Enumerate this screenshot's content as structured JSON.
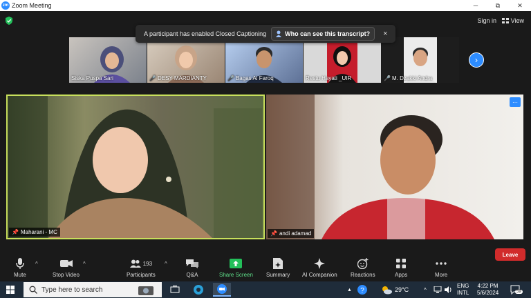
{
  "window": {
    "title": "Zoom Meeting",
    "app_logo": "zm",
    "minimize": "─",
    "maximize": "⧉",
    "close": "✕"
  },
  "top_bar": {
    "sign_in": "Sign in",
    "view": "View"
  },
  "banner": {
    "message": "A participant has enabled Closed Captioning",
    "button": "Who can see this transcript?",
    "close": "×"
  },
  "thumbnails": [
    {
      "name": "Siska Puspa Sari",
      "muted": false,
      "bg": "#8a8f99"
    },
    {
      "name": "DESY MARDIANTY",
      "muted": true,
      "bg": "#b7a694"
    },
    {
      "name": "Bagas Al Faroq",
      "muted": true,
      "bg": "#7d8eac"
    },
    {
      "name": "Restu Hayati _UIR",
      "muted": false,
      "bg": "#d8d8d8"
    },
    {
      "name": "M. Dzakki Andra",
      "muted": true,
      "bg": "#e9e9e9"
    }
  ],
  "next_page": "›",
  "tiles": {
    "left": {
      "name": "Maharani - MC"
    },
    "right": {
      "name": "andi adamad",
      "more": "···"
    }
  },
  "toolbar": {
    "mute": "Mute",
    "stop_video": "Stop Video",
    "participants": "Participants",
    "participants_count": "193",
    "qa": "Q&A",
    "share_screen": "Share Screen",
    "summary": "Summary",
    "ai_companion": "AI Companion",
    "reactions": "Reactions",
    "apps": "Apps",
    "more": "More",
    "leave": "Leave",
    "caret": "^"
  },
  "taskbar": {
    "search_placeholder": "Type here to search",
    "temperature": "29°C",
    "lang_top": "ENG",
    "lang_bottom": "INTL",
    "time": "4:22 PM",
    "date": "5/6/2024",
    "notifications": "59"
  },
  "colors": {
    "accent": "#2d8cff",
    "share_green": "#5fe08a",
    "leave_red": "#d12b2b",
    "speaker_border": "#c8e05c"
  }
}
